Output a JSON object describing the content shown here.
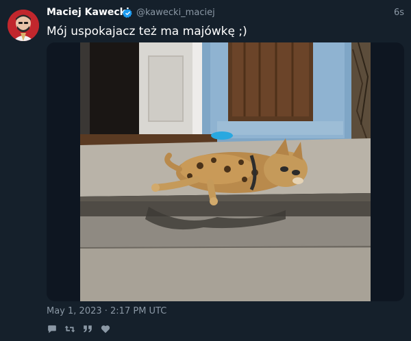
{
  "tweet": {
    "author_name": "Maciej Kawecki",
    "handle": "@kawecki_maciej",
    "time_ago": "6s",
    "text": "Mój uspokajacz też ma majówkę ;)",
    "date": "May 1, 2023 · 2:17 PM UTC",
    "verified": true
  },
  "actions": [
    {
      "name": "reply-icon",
      "glyph": "💬"
    },
    {
      "name": "retweet-icon",
      "glyph": "⟲"
    },
    {
      "name": "quote-icon",
      "glyph": "❞"
    },
    {
      "name": "like-icon",
      "glyph": "♥"
    }
  ],
  "colors": {
    "background": "#15202b",
    "muted_text": "#8b98a5",
    "verified_badge": "#1d9bf0"
  }
}
